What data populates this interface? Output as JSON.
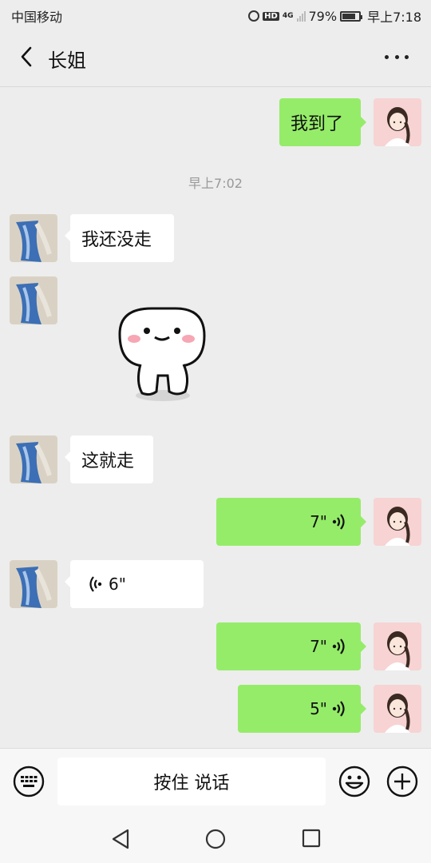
{
  "status_bar": {
    "carrier": "中国移动",
    "network": "4G",
    "battery_percent": "79%",
    "battery_level": 0.79,
    "time": "早上7:18"
  },
  "header": {
    "title": "长姐"
  },
  "messages": [
    {
      "from": "me",
      "type": "text",
      "text": "我到了"
    },
    {
      "type": "time",
      "text": "早上7:02"
    },
    {
      "from": "contact",
      "type": "text",
      "text": "我还没走"
    },
    {
      "from": "contact",
      "type": "sticker",
      "sticker": "white-blob-sticker"
    },
    {
      "from": "contact",
      "type": "text",
      "text": "这就走"
    },
    {
      "from": "me",
      "type": "voice",
      "duration": "7\""
    },
    {
      "from": "contact",
      "type": "voice",
      "duration": "6\""
    },
    {
      "from": "me",
      "type": "voice",
      "duration": "7\""
    },
    {
      "from": "me",
      "type": "voice",
      "duration": "5\""
    }
  ],
  "input_bar": {
    "hold_to_talk": "按住 说话"
  },
  "colors": {
    "bubble_out": "#95ec69",
    "bubble_in": "#ffffff",
    "background": "#ededed"
  }
}
